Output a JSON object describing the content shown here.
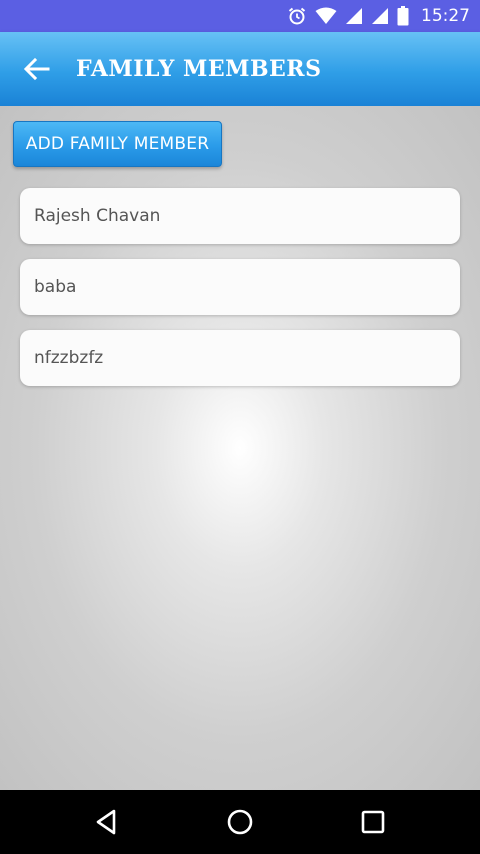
{
  "status_bar": {
    "time": "15:27",
    "icons": [
      "alarm-icon",
      "wifi-icon",
      "signal-icon",
      "signal-icon",
      "battery-icon"
    ]
  },
  "app_bar": {
    "title": "FAMILY MEMBERS",
    "back_icon": "arrow-left-icon"
  },
  "actions": {
    "add_label": "ADD FAMILY MEMBER"
  },
  "members": [
    {
      "name": "Rajesh Chavan"
    },
    {
      "name": "baba"
    },
    {
      "name": "nfzzbzfz"
    }
  ],
  "nav_bar": {
    "icons": [
      "back-triangle-icon",
      "home-circle-icon",
      "recents-square-icon"
    ]
  },
  "colors": {
    "status_bar": "#5b5fe3",
    "app_bar": "#2f9ee7",
    "button": "#2a9be9",
    "card": "#fbfbfb",
    "text": "#555555"
  }
}
